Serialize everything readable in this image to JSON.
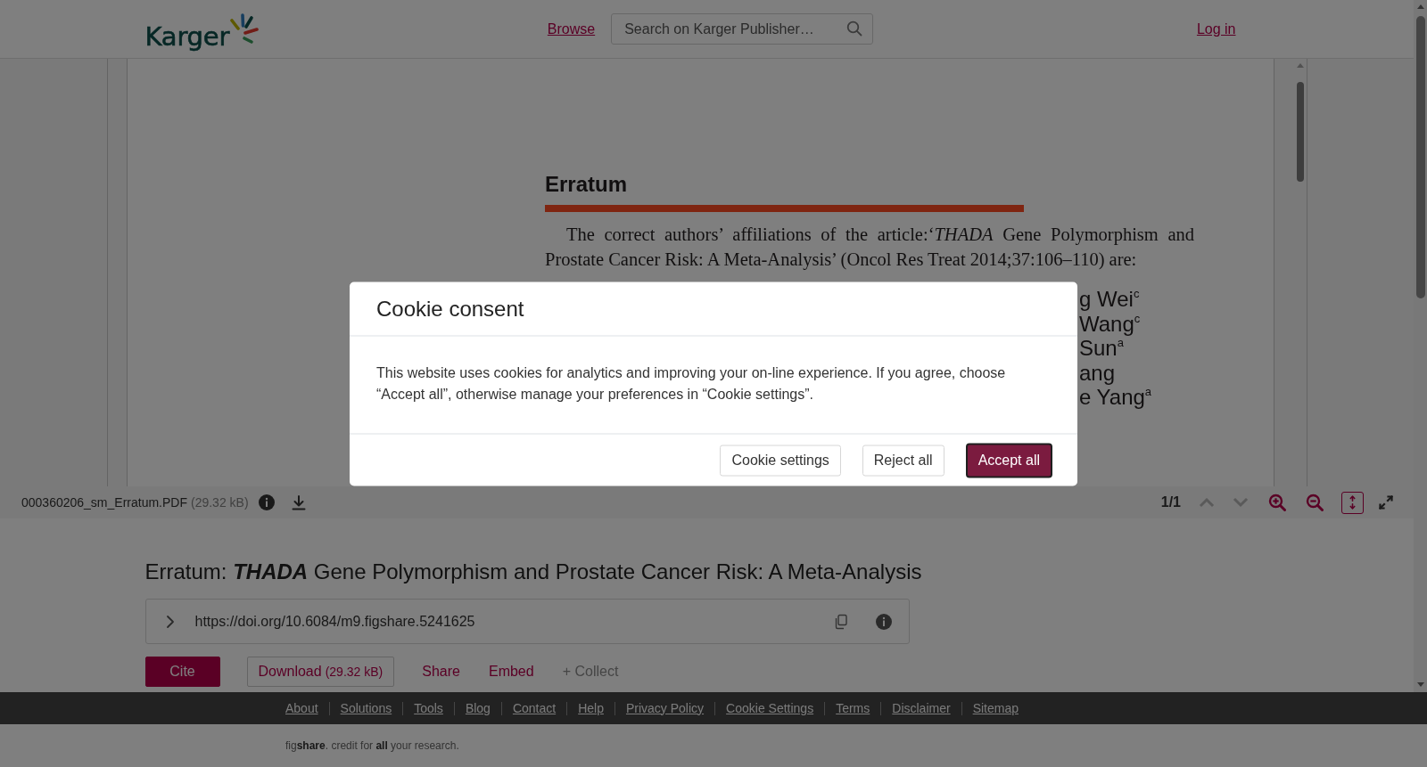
{
  "header": {
    "logo_text": "Karger",
    "nav_link": "Browse",
    "search": {
      "placeholder": "Search on Karger Publisher…"
    },
    "login_link": "Log in"
  },
  "viewer": {
    "document": {
      "heading": "Erratum",
      "paragraph": "The correct authors’ affiliations of the article:‘*THADA* Gene Polymorphism and Prostate Cancer Risk: A Meta-Analysis’ (Oncol Res Treat 2014;37:106–110) are:",
      "names": [
        "g Wei$^{c}$",
        "Wang$^{c}$",
        "Sun$^{a}$",
        "ang",
        "e Yang$^{a}$"
      ]
    },
    "toolbar": {
      "file_name": "000360206_sm_Erratum.PDF",
      "file_size": "(29.32 kB)",
      "page_label": "1/1",
      "page_nav": [
        {
          "kind": "up",
          "disabled": true
        },
        {
          "kind": "down",
          "disabled": true
        }
      ],
      "zoom": [
        {
          "kind": "in"
        },
        {
          "kind": "out"
        }
      ],
      "fit_height": {
        "on": true
      }
    }
  },
  "item": {
    "title": "Erratum: **THADA** Gene Polymorphism and Prostate Cancer Risk: A Meta-Analysis",
    "doi": {
      "url": "https://doi.org/10.6084/m9.figshare.5241625",
      "expanded": false
    },
    "actions": [
      {
        "label": "Cite",
        "kind": "primary"
      },
      {
        "label": "Download",
        "note": "(29.32 kB)",
        "kind": "outline"
      },
      {
        "label": "Share",
        "kind": "link"
      },
      {
        "label": "Embed",
        "kind": "link"
      },
      {
        "label": "+ Collect",
        "kind": "muted"
      }
    ]
  },
  "footer": {
    "links": [
      "About",
      "Solutions",
      "Tools",
      "Blog",
      "Contact",
      "Help",
      "Privacy Policy",
      "Cookie Settings",
      "Terms",
      "Disclaimer",
      "Sitemap"
    ],
    "credit": "fig**share**. credit for **all** your research."
  },
  "cookie_dialog": {
    "title": "Cookie consent",
    "body": "This website uses cookies for analytics and improving your on-line experience. If you agree, choose “Accept all”, otherwise manage your preferences in “Cookie settings”.",
    "buttons": [
      {
        "label": "Cookie settings",
        "kind": "secondary",
        "focused": false
      },
      {
        "label": "Reject all",
        "kind": "secondary",
        "focused": false
      },
      {
        "label": "Accept all",
        "kind": "primary",
        "focused": true
      }
    ]
  }
}
